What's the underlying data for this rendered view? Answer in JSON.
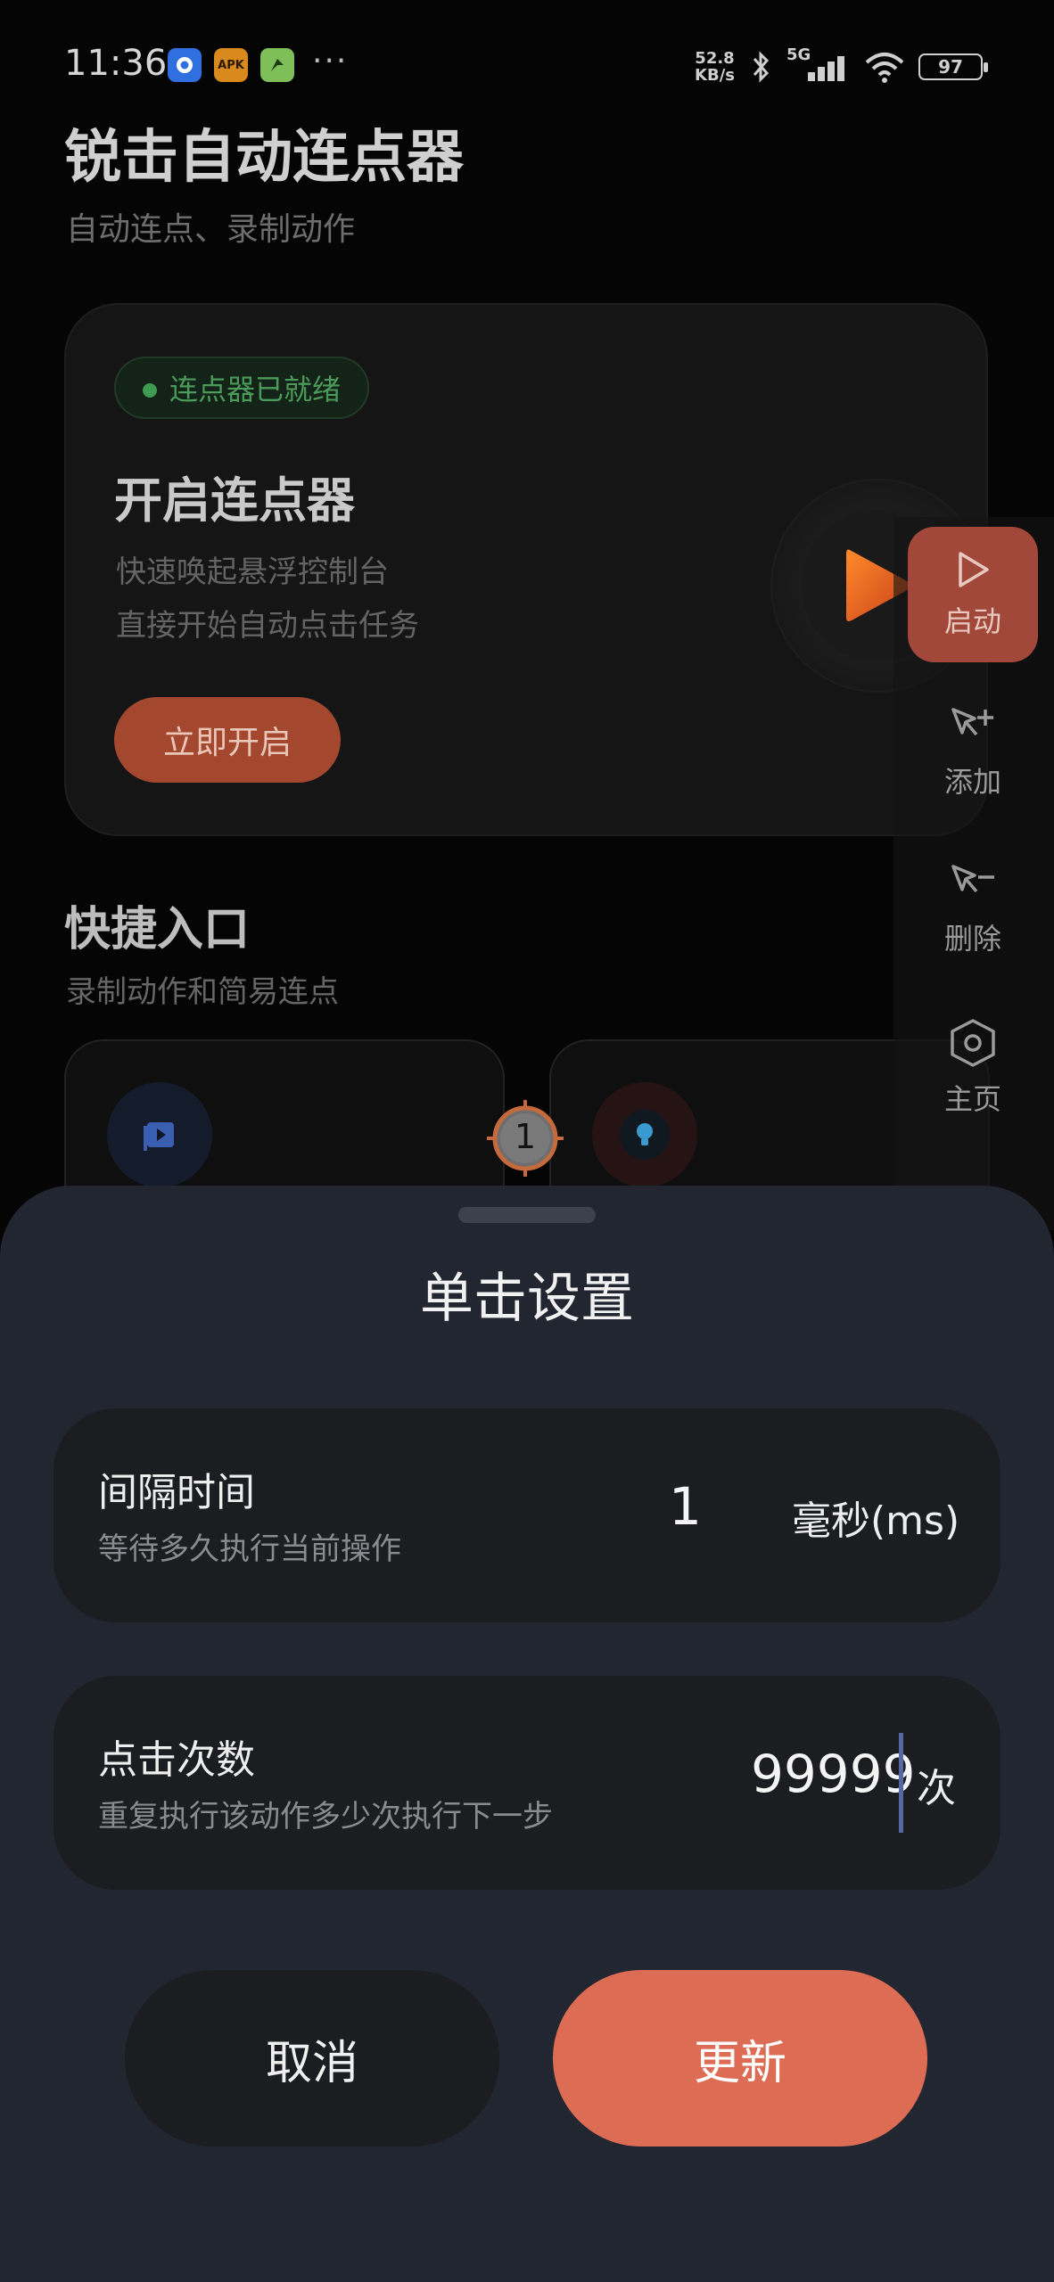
{
  "status_bar": {
    "time": "11:36",
    "app_icons": [
      {
        "name": "browser-app-icon",
        "label": "",
        "bg": "#2f6fe0",
        "fg": "#ffffff"
      },
      {
        "name": "apk-app-icon",
        "label": "APK",
        "bg": "#d98a1d",
        "fg": "#2b1a00"
      },
      {
        "name": "game-app-icon",
        "label": "",
        "bg": "#7fbf5a",
        "fg": "#1c3b10"
      }
    ],
    "more": "···",
    "net_speed_value": "52.8",
    "net_speed_unit": "KB/s",
    "network": "5G",
    "battery": "97"
  },
  "app": {
    "title": "锐击自动连点器",
    "subtitle": "自动连点、录制动作"
  },
  "hero": {
    "status_pill": "连点器已就绪",
    "title": "开启连点器",
    "line1": "快速唤起悬浮控制台",
    "line2": "直接开始自动点击任务",
    "button": "立即开启"
  },
  "quick": {
    "title": "快捷入口",
    "subtitle": "录制动作和简易连点"
  },
  "float_toolbar": {
    "items": [
      {
        "name": "start",
        "label": "启动",
        "icon": "play-outline-icon"
      },
      {
        "name": "add",
        "label": "添加",
        "icon": "cursor-plus-icon"
      },
      {
        "name": "delete",
        "label": "删除",
        "icon": "cursor-minus-icon"
      },
      {
        "name": "home",
        "label": "主页",
        "icon": "hexagon-icon"
      }
    ]
  },
  "target_marker": {
    "number": "1"
  },
  "sheet": {
    "title": "单击设置",
    "interval": {
      "label": "间隔时间",
      "desc": "等待多久执行当前操作",
      "value": "1",
      "unit": "毫秒(ms)"
    },
    "count": {
      "label": "点击次数",
      "desc": "重复执行该动作多少次执行下一步",
      "value": "99999",
      "unit": "次"
    },
    "cancel": "取消",
    "update": "更新"
  },
  "colors": {
    "accent": "#dd6c54",
    "sheet_bg": "#222631",
    "row_bg": "#1c1d21",
    "ready_green": "#3f9a52"
  }
}
